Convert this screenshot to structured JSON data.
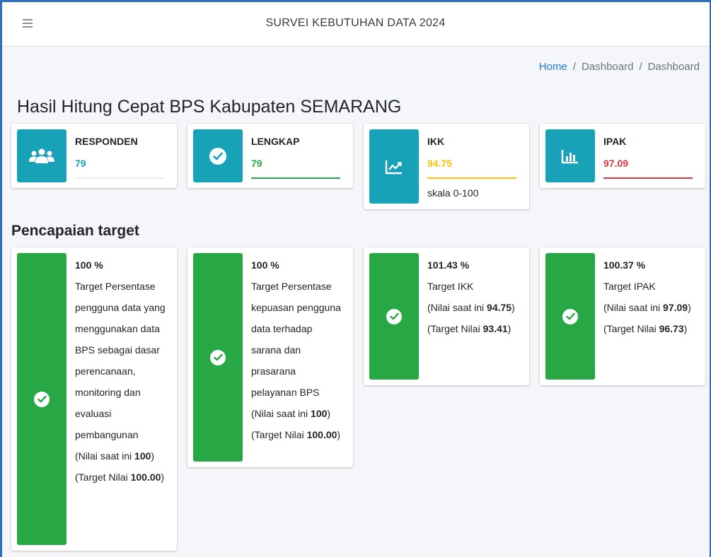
{
  "header": {
    "title": "SURVEI KEBUTUHAN DATA 2024",
    "menu_icon": "hamburger-icon"
  },
  "breadcrumb": {
    "home": "Home",
    "sep1": "/",
    "item1": "Dashboard",
    "sep2": "/",
    "item2": "Dashboard"
  },
  "page_title": "Hasil Hitung Cepat BPS Kabupaten SEMARANG",
  "info_cards": [
    {
      "label": "RESPONDEN",
      "value": "79",
      "icon": "users-icon",
      "value_color": "#17a2b8",
      "bar_color": "#e9ecef",
      "note": ""
    },
    {
      "label": "LENGKAP",
      "value": "79",
      "icon": "check-circle-icon",
      "value_color": "#28a745",
      "bar_color": "#28a745",
      "note": ""
    },
    {
      "label": "IKK",
      "value": "94.75",
      "icon": "chart-line-icon",
      "value_color": "#ffc107",
      "bar_color": "#ffc107",
      "note": "skala 0-100"
    },
    {
      "label": "IPAK",
      "value": "97.09",
      "icon": "chart-bar-icon",
      "value_color": "#dc3545",
      "bar_color": "#dc3545",
      "note": ""
    }
  ],
  "section_title": "Pencapaian target",
  "targets": [
    {
      "pct": "100 %",
      "desc": "Target Persentase pengguna data yang menggunakan data BPS sebagai dasar perencanaan, monitoring dan evaluasi pembangunan",
      "current_prefix": "(Nilai saat ini ",
      "current": "100",
      "current_suffix": ")",
      "target_prefix": "(Target Nilai ",
      "target": "100.00",
      "target_suffix": ")"
    },
    {
      "pct": "100 %",
      "desc": "Target Persentase kepuasan pengguna data terhadap sarana dan prasarana pelayanan BPS",
      "current_prefix": "(Nilai saat ini ",
      "current": "100",
      "current_suffix": ")",
      "target_prefix": "(Target Nilai ",
      "target": "100.00",
      "target_suffix": ")"
    },
    {
      "pct": "101.43 %",
      "desc": "Target IKK",
      "current_prefix": "(Nilai saat ini ",
      "current": "94.75",
      "current_suffix": ")",
      "target_prefix": "(Target Nilai ",
      "target": "93.41",
      "target_suffix": ")"
    },
    {
      "pct": "100.37 %",
      "desc": "Target IPAK",
      "current_prefix": "(Nilai saat ini ",
      "current": "97.09",
      "current_suffix": ")",
      "target_prefix": "(Target Nilai ",
      "target": "96.73",
      "target_suffix": ")"
    }
  ],
  "colors": {
    "info_icon_bg": "#17a2b8",
    "success": "#28a745",
    "link": "#1f7bd6"
  }
}
